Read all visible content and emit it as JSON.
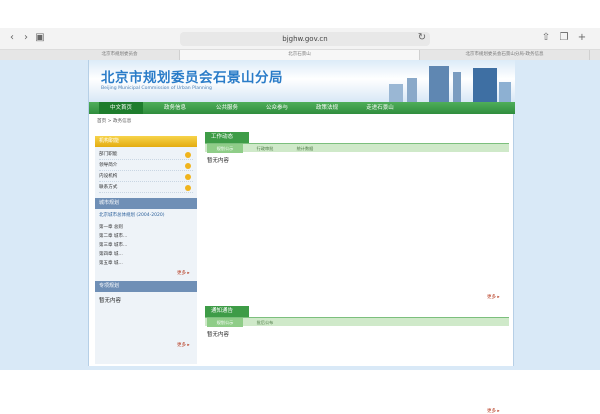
{
  "browser": {
    "url": "bjghw.gov.cn",
    "tabs": [
      {
        "label": "北京市规划委员会"
      },
      {
        "label": "北京石景山"
      },
      {
        "label": "北京市规划委员会石景山分局-政务信息"
      }
    ]
  },
  "site": {
    "title": "北京市规划委员会石景山分局",
    "subtitle": "Beijing Municipal Commission of Urban Planning"
  },
  "nav": {
    "items": [
      {
        "label": "中文首页"
      },
      {
        "label": "政务信息"
      },
      {
        "label": "公共服务"
      },
      {
        "label": "公众参与"
      },
      {
        "label": "政策法规"
      },
      {
        "label": "走进石景山"
      }
    ]
  },
  "breadcrumb": "首页 > 政务信息",
  "sidebar": {
    "info_title": "机构职能",
    "links": [
      {
        "label": "部门职能"
      },
      {
        "label": "领导简介"
      },
      {
        "label": "内设机构"
      },
      {
        "label": "联系方式"
      }
    ],
    "plan_title": "城市规划",
    "plan_subtitle": "北京城市总体规划 (2004-2020)",
    "chapters": [
      {
        "label": "第一章 总则"
      },
      {
        "label": "第二章 城市…"
      },
      {
        "label": "第三章 城市…"
      },
      {
        "label": "第四章 城…"
      },
      {
        "label": "第五章 城…"
      }
    ],
    "more": "更多 ▸",
    "special_title": "专项规划",
    "special_empty": "暂无内容",
    "more2": "更多 ▸"
  },
  "main": {
    "work_title": "工作动态",
    "work_tabs": [
      {
        "label": "规划公示"
      },
      {
        "label": "行政审批"
      },
      {
        "label": "统计数据"
      }
    ],
    "work_empty": "暂无内容",
    "more": "更多 ▸",
    "notice_title": "通知通告",
    "notice_tabs": [
      {
        "label": "规划公示"
      },
      {
        "label": "批后公布"
      }
    ],
    "notice_empty": "暂无内容",
    "more2": "更多 ▸"
  },
  "colors": {
    "nav_green": "#3e9c47",
    "title_blue": "#2a7cc8",
    "gold": "#e3ac11"
  }
}
